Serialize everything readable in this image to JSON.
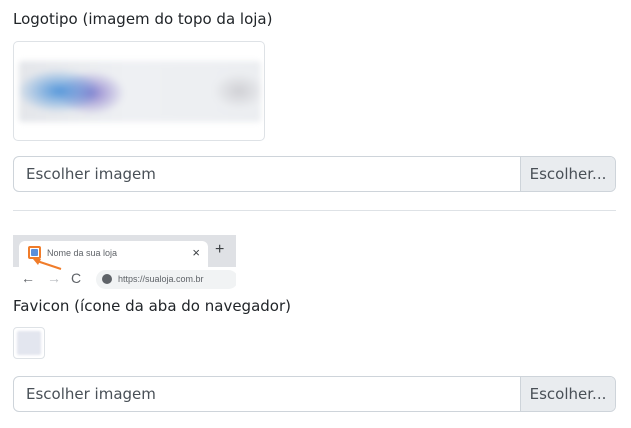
{
  "logo": {
    "label": "Logotipo (imagem do topo da loja)",
    "file_placeholder": "Escolher imagem",
    "file_button": "Escolher..."
  },
  "browser_preview": {
    "tab_title": "Nome da sua loja",
    "close_glyph": "×",
    "new_tab_glyph": "+",
    "back_glyph": "←",
    "forward_glyph": "→",
    "reload_glyph": "C",
    "url": "https://sualoja.com.br"
  },
  "favicon": {
    "label": "Favicon (ícone da aba do navegador)",
    "file_placeholder": "Escolher imagem",
    "file_button": "Escolher..."
  },
  "colors": {
    "highlight": "#f07c2a",
    "favicon_blue": "#5a8fdc"
  }
}
